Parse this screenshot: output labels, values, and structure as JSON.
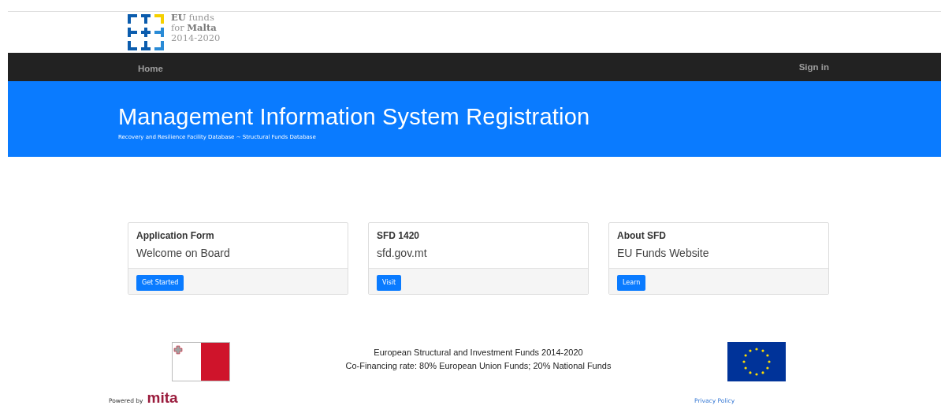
{
  "logo": {
    "line_1_bold": "EU",
    "line_1": "funds",
    "line_2": "for",
    "line_2_bold": "Malta",
    "line_3": "2014-2020"
  },
  "navbar": {
    "items": [
      {
        "label": "Home"
      }
    ],
    "sign_in": "Sign in"
  },
  "header": {
    "title": "Management Information System Registration",
    "subtitle": "Recovery and Resilience Facility Database ~ Structural Funds Database"
  },
  "cards": [
    {
      "title": "Application Form",
      "text": "Welcome on Board",
      "button": "Get Started"
    },
    {
      "title": "SFD 1420",
      "text": "sfd.gov.mt",
      "button": "Visit"
    },
    {
      "title": "About SFD",
      "text": "EU Funds Website",
      "button": "Learn"
    }
  ],
  "footer": {
    "lines": [
      "European Structural and Investment Funds 2014-2020",
      "Co-Financing rate: 80% European Union Funds; 20% National Funds"
    ],
    "powered_by": "Powered by",
    "powered_logo": "mita",
    "privacy_link": "Privacy Policy"
  }
}
